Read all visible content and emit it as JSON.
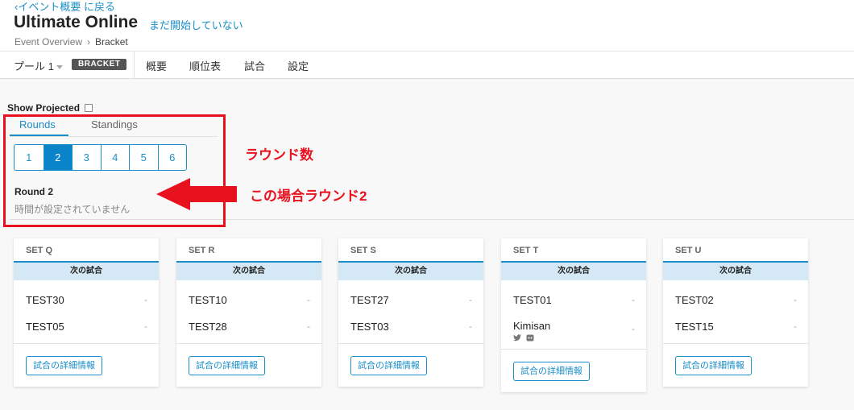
{
  "header": {
    "back_link": "‹イベント概要 に戻る",
    "title": "Ultimate Online",
    "status": "まだ開始していない",
    "breadcrumb": {
      "parent": "Event Overview",
      "current": "Bracket"
    }
  },
  "nav": {
    "pool": "プール 1",
    "badge": "BRACKET",
    "items": [
      "概要",
      "順位表",
      "試合",
      "設定"
    ]
  },
  "controls": {
    "show_projected": "Show Projected",
    "show_projected_checked": false
  },
  "tabs": [
    "Rounds",
    "Standings"
  ],
  "rounds": {
    "pages": [
      "1",
      "2",
      "3",
      "4",
      "5",
      "6"
    ],
    "active": "2",
    "current_title": "Round 2",
    "current_time": "時間が設定されていません"
  },
  "annotation": {
    "label_round_count": "ラウンド数",
    "label_this_case": "この場合ラウンド2",
    "color": "#e8121f"
  },
  "matches": [
    {
      "set": "SET Q",
      "next": "次の試合",
      "teams": [
        {
          "name": "TEST30",
          "score": "-"
        },
        {
          "name": "TEST05",
          "score": "-"
        }
      ],
      "button": "試合の詳細情報"
    },
    {
      "set": "SET R",
      "next": "次の試合",
      "teams": [
        {
          "name": "TEST10",
          "score": "-"
        },
        {
          "name": "TEST28",
          "score": "-"
        }
      ],
      "button": "試合の詳細情報"
    },
    {
      "set": "SET S",
      "next": "次の試合",
      "teams": [
        {
          "name": "TEST27",
          "score": "-"
        },
        {
          "name": "TEST03",
          "score": "-"
        }
      ],
      "button": "試合の詳細情報"
    },
    {
      "set": "SET T",
      "next": "次の試合",
      "teams": [
        {
          "name": "TEST01",
          "score": "-"
        },
        {
          "name": "Kimisan",
          "score": "-",
          "icons": [
            "twitter-icon",
            "discord-icon"
          ]
        }
      ],
      "button": "試合の詳細情報"
    },
    {
      "set": "SET U",
      "next": "次の試合",
      "teams": [
        {
          "name": "TEST02",
          "score": "-"
        },
        {
          "name": "TEST15",
          "score": "-"
        }
      ],
      "button": "試合の詳細情報"
    }
  ],
  "colors": {
    "accent": "#1a8ec8",
    "active_page": "#0a84c8",
    "next_bar": "#d4e8f5",
    "badge": "#555555"
  }
}
